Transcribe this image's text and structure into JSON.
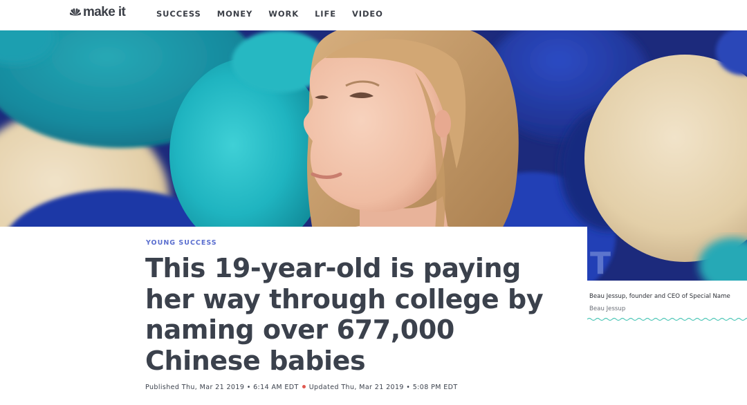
{
  "site": {
    "logo_text": "make it",
    "logo_icon": "peacock-icon"
  },
  "nav": {
    "items": [
      {
        "label": "SUCCESS"
      },
      {
        "label": "MONEY"
      },
      {
        "label": "WORK"
      },
      {
        "label": "LIFE"
      },
      {
        "label": "VIDEO"
      }
    ]
  },
  "article": {
    "kicker": "YOUNG SUCCESS",
    "headline": "This 19-year-old is paying her way through college by naming over 677,000 Chinese babies",
    "published": "Published Thu, Mar 21 2019 • 6:14 AM EDT",
    "updated": "Updated Thu, Mar 21 2019 • 5:08 PM EDT"
  },
  "image": {
    "caption": "Beau Jessup, founder and CEO of Special Name",
    "credit": "Beau Jessup"
  },
  "colors": {
    "accent": "#5a6ecf",
    "wave": "#4fc7b7",
    "date_dot": "#e0584f",
    "text": "#3b414c"
  }
}
